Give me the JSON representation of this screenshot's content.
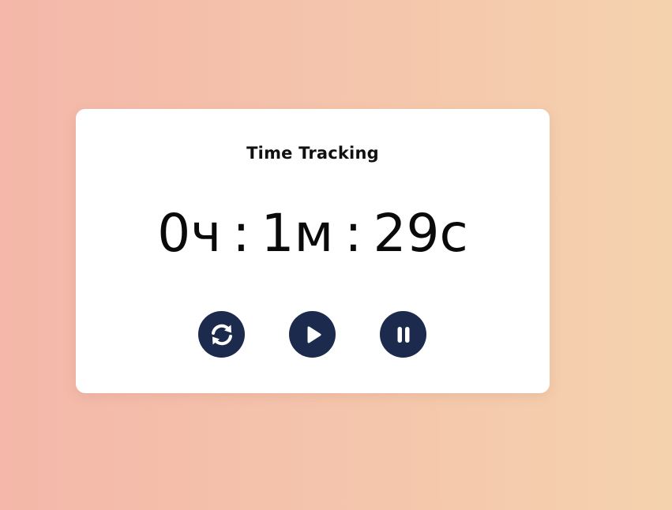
{
  "app": {
    "title": "Time Tracking"
  },
  "timer": {
    "hours": "0ч",
    "minutes": "1м",
    "seconds": "29с",
    "separator": ":"
  },
  "controls": [
    {
      "name": "reset",
      "icon": "refresh-icon"
    },
    {
      "name": "play",
      "icon": "play-icon"
    },
    {
      "name": "pause",
      "icon": "pause-icon"
    }
  ],
  "colors": {
    "background_gradient_start": "#f4b7a9",
    "background_gradient_end": "#f5d2ae",
    "card": "#ffffff",
    "button": "#1c2a4e",
    "icon": "#ffffff",
    "text": "#0a0a0a"
  }
}
